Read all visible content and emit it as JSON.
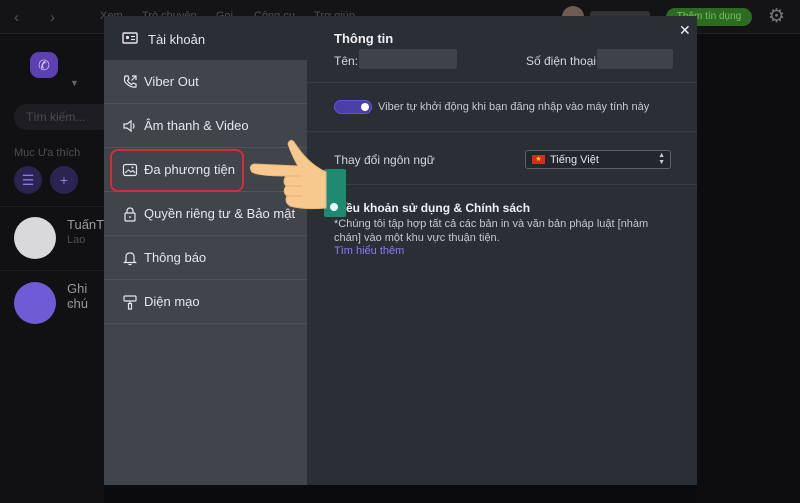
{
  "background_app": {
    "top_menu": [
      "Xem",
      "Trò chuyện",
      "Gọi",
      "Công cụ",
      "Trợ giúp"
    ],
    "credit_button": "Thêm tín dụng",
    "search_placeholder": "Tìm kiếm...",
    "favorites_label": "Mục Ưa thích",
    "chats": [
      {
        "title": "TuấnTu",
        "subtitle": "Lao"
      },
      {
        "title": "Ghi chú",
        "subtitle": "+"
      }
    ]
  },
  "settings": {
    "sidebar": {
      "items": [
        {
          "label": "Tài khoản",
          "icon": "account-card-icon"
        },
        {
          "label": "Viber Out",
          "icon": "phone-out-icon"
        },
        {
          "label": "Âm thanh & Video",
          "icon": "speaker-icon"
        },
        {
          "label": "Đa phương tiện",
          "icon": "media-image-icon"
        },
        {
          "label": "Quyền riêng tư & Bảo mật",
          "icon": "lock-icon"
        },
        {
          "label": "Thông báo",
          "icon": "bell-icon"
        },
        {
          "label": "Diện mạo",
          "icon": "paint-roller-icon"
        }
      ],
      "active_index": 0,
      "highlighted_index": 3
    },
    "info": {
      "title": "Thông tin",
      "name_label": "Tên:",
      "phone_label": "Số điện thoại:"
    },
    "startup": {
      "enabled": true,
      "text": "Viber tự khởi động khi bạn đăng nhập vào máy tính này"
    },
    "language": {
      "label": "Thay đổi ngôn ngữ",
      "selected": "Tiếng Việt"
    },
    "terms": {
      "title": "Điều khoản sử dụng & Chính sách",
      "text": "*Chúng tôi tập hợp tất cả các bản in và văn bản pháp luật [nhàm chán] vào một khu vực thuận tiện.",
      "link": "Tìm hiểu thêm"
    },
    "colors": {
      "accent": "#7360f2",
      "highlight_border": "#d22e3a",
      "sidebar_bg": "#40444b",
      "content_bg": "#2a2e35"
    }
  }
}
